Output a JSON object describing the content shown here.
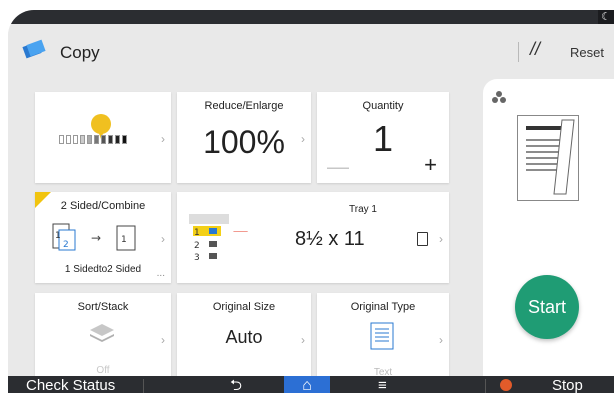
{
  "app": {
    "title": "Copy",
    "reset_label": "Reset"
  },
  "tiles": {
    "density": {
      "level_fraction": 0.55
    },
    "reduce_enlarge": {
      "label": "Reduce/Enlarge",
      "value": "100%"
    },
    "quantity": {
      "label": "Quantity",
      "value": "1",
      "minus": "—",
      "plus": "+"
    },
    "two_sided": {
      "label": "2 Sided/Combine",
      "mode": "1 Sidedto2 Sided",
      "more": "..."
    },
    "tray": {
      "label": "Tray 1",
      "paper_size": "8½ x 11",
      "tray_numbers": [
        "1",
        "2",
        "3"
      ]
    },
    "sort_stack": {
      "label": "Sort/Stack",
      "value": "Off"
    },
    "original_size": {
      "label": "Original Size",
      "value": "Auto"
    },
    "original_type": {
      "label": "Original Type",
      "value": "Text"
    }
  },
  "side": {
    "start_label": "Start"
  },
  "bottom": {
    "check_status": "Check Status",
    "back_glyph": "⮌",
    "home_glyph": "⌂",
    "menu_glyph": "≡",
    "stop_label": "Stop"
  },
  "colors": {
    "accent_green": "#1f9c74",
    "home_blue": "#2c6fd4",
    "warning_yellow": "#f1c40f"
  }
}
